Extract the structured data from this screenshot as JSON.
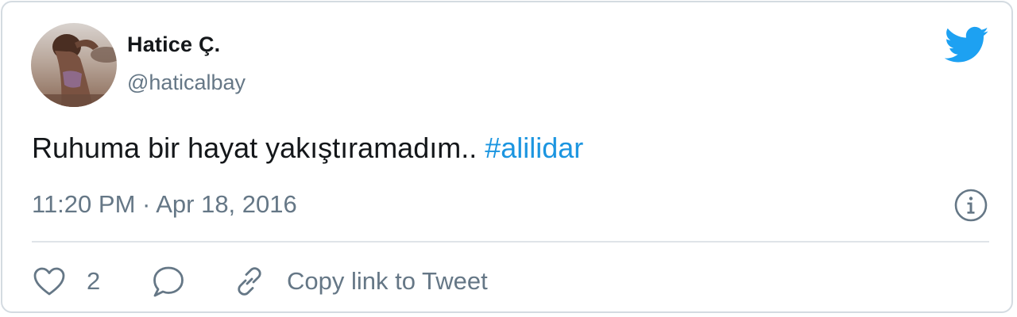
{
  "user": {
    "display_name": "Hatice Ç.",
    "handle": "@haticalbay"
  },
  "tweet": {
    "text": "Ruhuma bir hayat yakıştıramadım.. ",
    "hashtag": "#alilidar",
    "timestamp": "11:20 PM · Apr 18, 2016"
  },
  "actions": {
    "like_count": "2",
    "copy_link_label": "Copy link to Tweet"
  },
  "colors": {
    "brand_blue": "#1da1f2",
    "link_blue": "#1b95e0",
    "text_primary": "#14171a",
    "text_secondary": "#657786",
    "border": "#d4dbe1"
  },
  "icons": {
    "brand": "twitter-bird-icon",
    "info": "info-icon",
    "like": "heart-icon",
    "reply": "reply-icon",
    "copy_link": "link-icon"
  }
}
